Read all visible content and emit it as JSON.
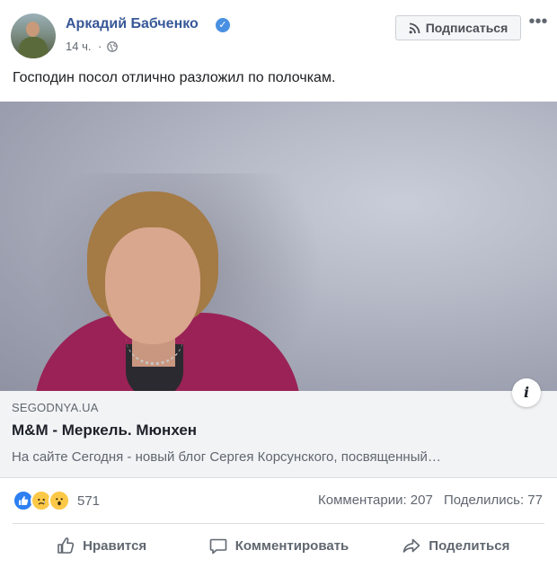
{
  "post": {
    "author": "Аркадий Бабченко",
    "time": "14 ч.",
    "text": "Господин посол отлично разложил по полочкам.",
    "subscribe_label": "Подписаться",
    "more_label": "•••"
  },
  "link": {
    "domain": "SEGODNYA.UA",
    "title": "M&M - Меркель. Мюнхен",
    "description": "На сайте Сегодня - новый блог Сергея Корсунского, посвященный…",
    "info_label": "i"
  },
  "stats": {
    "reactions_count": "571",
    "comments": "Комментарии: 207",
    "shares": "Поделились: 77",
    "reaction_icons": [
      "like-icon",
      "sad-icon",
      "wow-icon"
    ]
  },
  "actions": {
    "like": "Нравится",
    "comment": "Комментировать",
    "share": "Поделиться"
  },
  "colors": {
    "author_link": "#385898",
    "verified": "#4a90e2",
    "like_blue": "#2d7ff2",
    "muted_text": "#606770",
    "link_box_bg": "#f2f3f5"
  }
}
